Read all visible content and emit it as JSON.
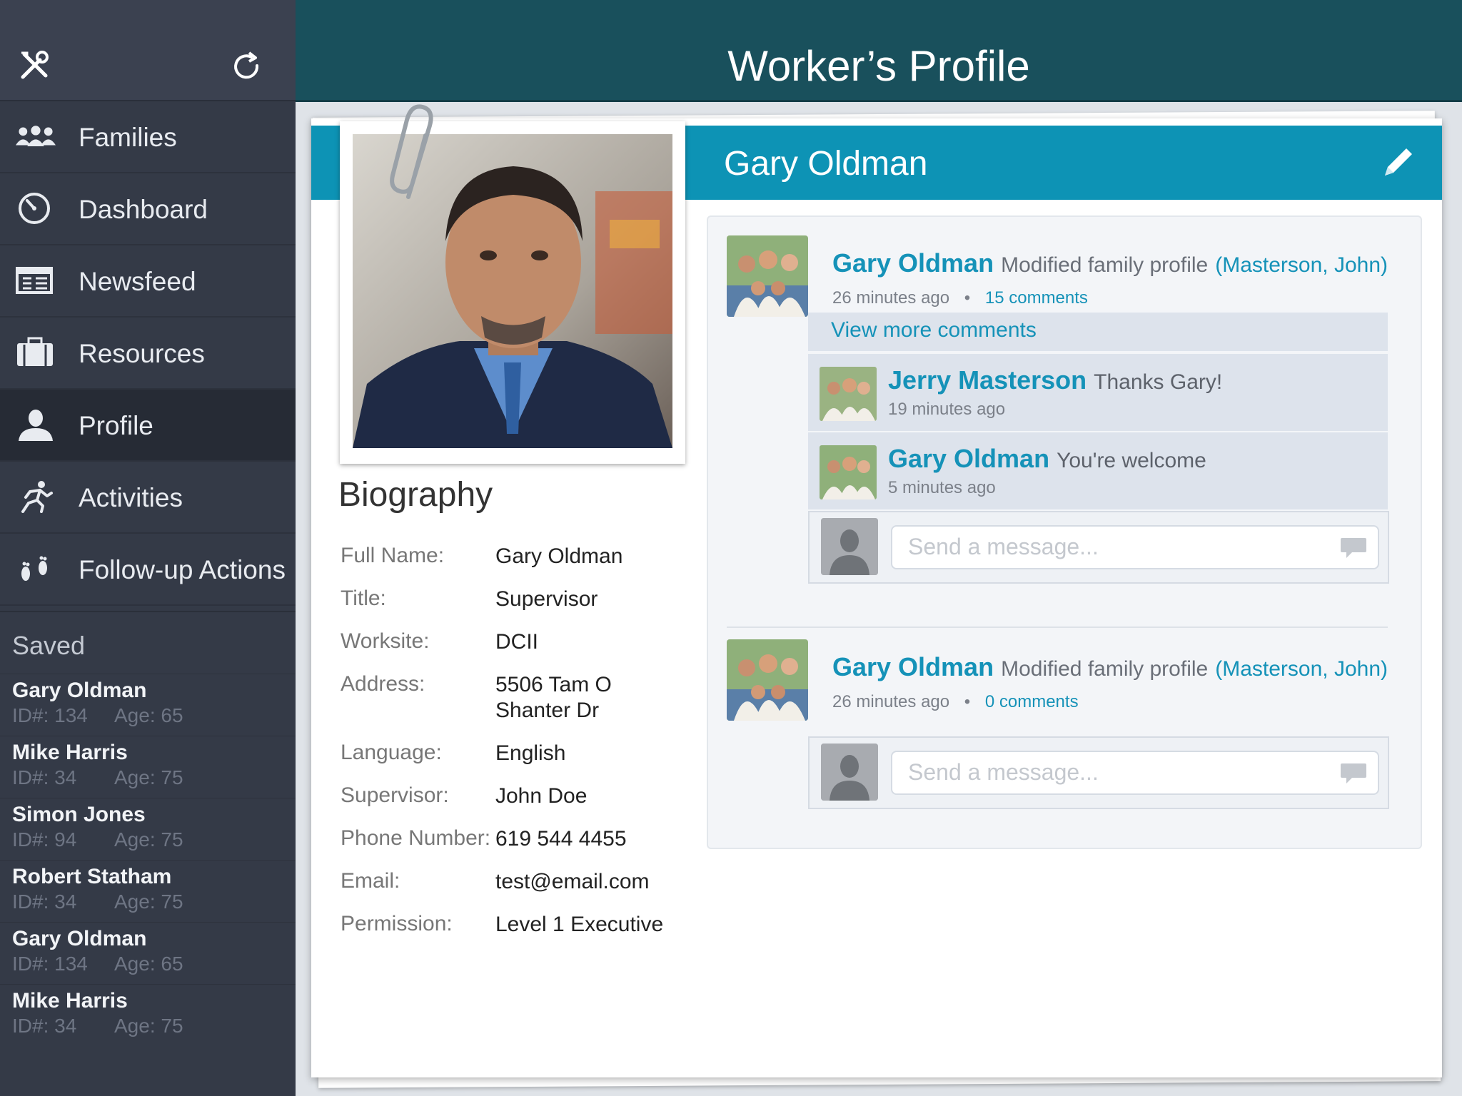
{
  "header": {
    "title": "Worker’s Profile"
  },
  "sidebar": {
    "top_icons": [
      "tools-icon",
      "refresh-icon"
    ],
    "nav": [
      {
        "label": "Families",
        "icon": "families-icon"
      },
      {
        "label": "Dashboard",
        "icon": "dashboard-icon"
      },
      {
        "label": "Newsfeed",
        "icon": "newsfeed-icon"
      },
      {
        "label": "Resources",
        "icon": "briefcase-icon"
      },
      {
        "label": "Profile",
        "icon": "person-icon",
        "active": true
      },
      {
        "label": "Activities",
        "icon": "running-icon"
      },
      {
        "label": "Follow-up Actions",
        "icon": "footprints-icon"
      }
    ],
    "saved_title": "Saved",
    "saved": [
      {
        "name": "Gary Oldman",
        "id": "ID#: 134",
        "age": "Age: 65"
      },
      {
        "name": "Mike Harris",
        "id": "ID#: 34",
        "age": "Age: 75"
      },
      {
        "name": "Simon Jones",
        "id": "ID#: 94",
        "age": "Age: 75"
      },
      {
        "name": "Robert Statham",
        "id": "ID#: 34",
        "age": "Age: 75"
      },
      {
        "name": "Gary Oldman",
        "id": "ID#: 134",
        "age": "Age: 65"
      },
      {
        "name": "Mike Harris",
        "id": "ID#: 34",
        "age": "Age: 75"
      }
    ]
  },
  "profile": {
    "name": "Gary Oldman",
    "biography_title": "Biography",
    "fields": [
      {
        "label": "Full Name:",
        "value": "Gary Oldman"
      },
      {
        "label": "Title:",
        "value": "Supervisor"
      },
      {
        "label": "Worksite:",
        "value": "DCII"
      },
      {
        "label": "Address:",
        "value": "5506 Tam O Shanter Dr"
      },
      {
        "label": "Language:",
        "value": "English"
      },
      {
        "label": "Supervisor:",
        "value": "John Doe"
      },
      {
        "label": "Phone Number:",
        "value": "619 544 4455"
      },
      {
        "label": "Email:",
        "value": "test@email.com"
      },
      {
        "label": "Permission:",
        "value": "Level 1 Executive"
      }
    ]
  },
  "feed": {
    "posts": [
      {
        "author": "Gary Oldman",
        "action": "Modified family profile",
        "target": "(Masterson, John)",
        "time": "26 minutes ago",
        "separator": "•",
        "comments_link": "15 comments",
        "view_more": "View more comments",
        "comments": [
          {
            "author": "Jerry Masterson",
            "text": "Thanks Gary!",
            "time": "19 minutes ago"
          },
          {
            "author": "Gary Oldman",
            "text": "You're welcome",
            "time": "5 minutes ago"
          }
        ],
        "message_placeholder": "Send a message..."
      },
      {
        "author": "Gary Oldman",
        "action": "Modified family profile",
        "target": "(Masterson, John)",
        "time": "26 minutes ago",
        "separator": "•",
        "comments_link": "0 comments",
        "message_placeholder": "Send a message..."
      }
    ]
  },
  "colors": {
    "sidebar": "#343a47",
    "header": "#19505c",
    "accent": "#0d93b5",
    "link": "#1592b8"
  }
}
